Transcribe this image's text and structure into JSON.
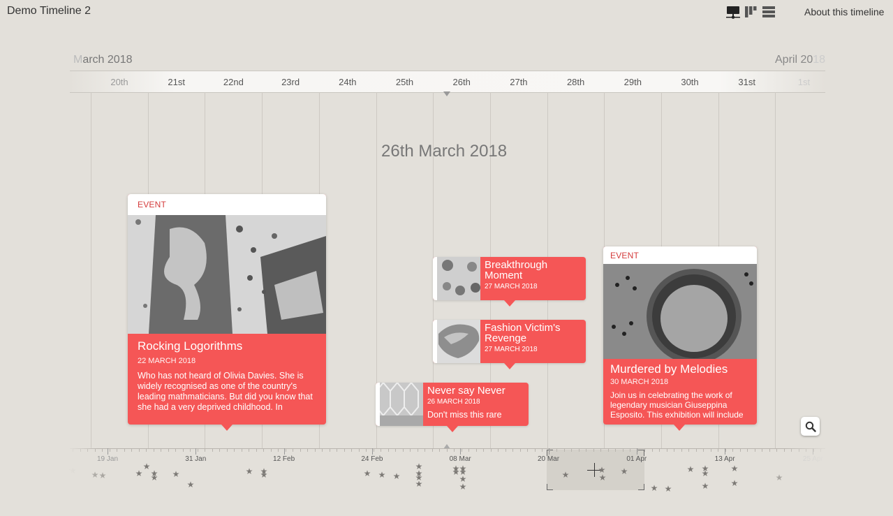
{
  "header": {
    "title": "Demo Timeline 2",
    "view_icons": [
      "timeline-view-icon",
      "masonry-view-icon",
      "list-view-icon"
    ],
    "about_label": "About this timeline"
  },
  "months": {
    "left": "March 2018",
    "left_fade": "M",
    "left_rest": "arch 2018",
    "right": "April 20",
    "right_fade": "18"
  },
  "days": [
    {
      "label": "20th",
      "style": "dim"
    },
    {
      "label": "21st",
      "style": ""
    },
    {
      "label": "22nd",
      "style": ""
    },
    {
      "label": "23rd",
      "style": ""
    },
    {
      "label": "24th",
      "style": ""
    },
    {
      "label": "25th",
      "style": ""
    },
    {
      "label": "26th",
      "style": ""
    },
    {
      "label": "27th",
      "style": ""
    },
    {
      "label": "28th",
      "style": ""
    },
    {
      "label": "29th",
      "style": ""
    },
    {
      "label": "30th",
      "style": ""
    },
    {
      "label": "31st",
      "style": ""
    },
    {
      "label": "1st",
      "style": "faint"
    }
  ],
  "current_date": "26th March 2018",
  "cards": [
    {
      "tag": "EVENT",
      "title": "Rocking Logorithms",
      "date": "22 MARCH 2018",
      "description": "Who has not heard of Olivia Davies. She is widely recognised as one of the country's leading mathmaticians. But did you know that she had a very deprived childhood. In"
    },
    {
      "tag": "EVENT",
      "title": "Murdered by Melodies",
      "date": "30 MARCH 2018",
      "description": "Join us in celebrating the work of legendary musician Giuseppina Esposito. This exhibition will include"
    }
  ],
  "small_cards": [
    {
      "title": "Breakthrough Moment",
      "date": "27 MARCH 2018",
      "description": ""
    },
    {
      "title": "Fashion Victim's Revenge",
      "date": "27 MARCH 2018",
      "description": ""
    },
    {
      "title": "Never say Never",
      "date": "26 MARCH 2018",
      "description": "Don't miss this rare"
    }
  ],
  "zoom_button": {
    "icon": "search-icon"
  },
  "overview": {
    "labels": [
      {
        "label": "19 Jan",
        "style": "dim"
      },
      {
        "label": "31 Jan",
        "style": ""
      },
      {
        "label": "12 Feb",
        "style": ""
      },
      {
        "label": "24 Feb",
        "style": ""
      },
      {
        "label": "08 Mar",
        "style": ""
      },
      {
        "label": "20 Mar",
        "style": ""
      },
      {
        "label": "01 Apr",
        "style": ""
      },
      {
        "label": "13 Apr",
        "style": ""
      },
      {
        "label": "25 Apr",
        "style": "faint"
      }
    ],
    "event_marker_count": 44
  },
  "colors": {
    "accent": "#f55656",
    "tag_text": "#d43b3b",
    "background": "#e3e0da"
  }
}
